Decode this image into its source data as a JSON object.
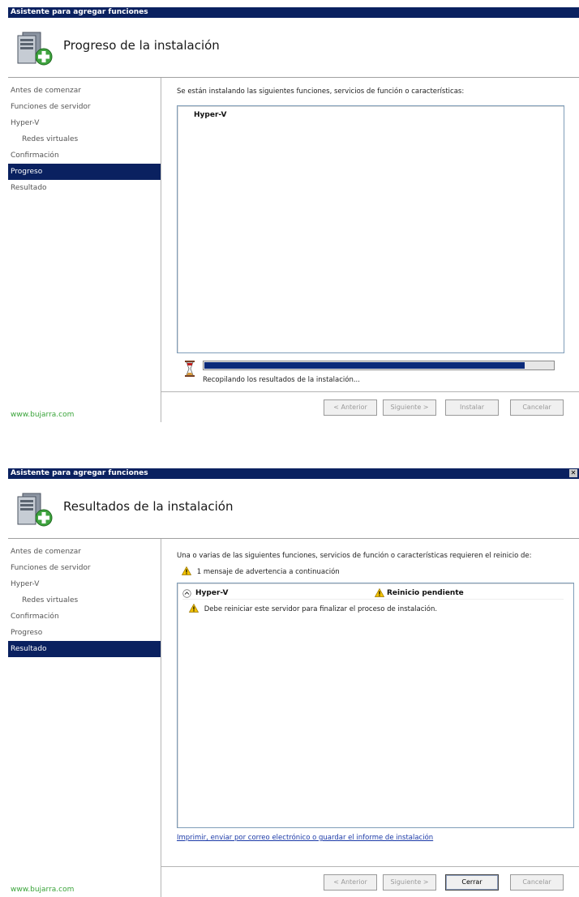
{
  "window1": {
    "title": "Asistente para agregar funciones",
    "header_title": "Progreso de la instalación",
    "nav": [
      {
        "label": "Antes de comenzar"
      },
      {
        "label": "Funciones de servidor"
      },
      {
        "label": "Hyper-V"
      },
      {
        "label": "Redes virtuales"
      },
      {
        "label": "Confirmación"
      },
      {
        "label": "Progreso"
      },
      {
        "label": "Resultado"
      }
    ],
    "active_nav": "Progreso",
    "intro_text": "Se están instalando las siguientes funciones, servicios de función o características:",
    "list_item": "Hyper-V",
    "progress_fraction": 0.92,
    "status_text": "Recopilando los resultados de la instalación...",
    "watermark": "www.bujarra.com",
    "buttons": {
      "back": "< Anterior",
      "next": "Siguiente >",
      "install": "Instalar",
      "cancel": "Cancelar"
    }
  },
  "window2": {
    "title": "Asistente para agregar funciones",
    "header_title": "Resultados de la instalación",
    "nav": [
      {
        "label": "Antes de comenzar"
      },
      {
        "label": "Funciones de servidor"
      },
      {
        "label": "Hyper-V"
      },
      {
        "label": "Redes virtuales"
      },
      {
        "label": "Confirmación"
      },
      {
        "label": "Progreso"
      },
      {
        "label": "Resultado"
      }
    ],
    "active_nav": "Resultado",
    "intro_text": "Una o varias de las siguientes funciones, servicios de función o características requieren el reinicio de:",
    "warning_summary": "1 mensaje de advertencia a continuación",
    "result_name": "Hyper-V",
    "result_status": "Reinicio pendiente",
    "result_message": "Debe reiniciar este servidor para finalizar el proceso de instalación.",
    "report_link": "Imprimir, enviar por correo electrónico o guardar el informe de instalación",
    "watermark": "www.bujarra.com",
    "buttons": {
      "back": "< Anterior",
      "next": "Siguiente >",
      "close": "Cerrar",
      "cancel": "Cancelar"
    }
  },
  "colors": {
    "titlebar": "#0a2160",
    "selected": "#0a2160",
    "progress": "#0a2a7a",
    "watermark": "#3aa43a",
    "link": "#1b3aa8",
    "warning": "#f2c200"
  }
}
